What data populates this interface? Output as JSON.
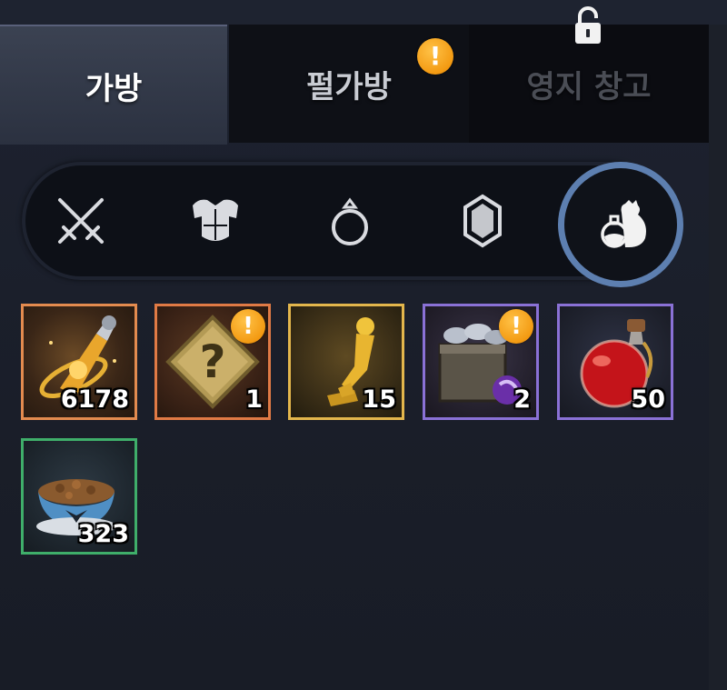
{
  "tabs": {
    "bag": "가방",
    "pearl_bag": "펄가방",
    "territory_storage": "영지 창고"
  },
  "alert_mark": "!",
  "filters": [
    {
      "name": "weapon-filter",
      "icon": "crossed-swords-icon",
      "active": false
    },
    {
      "name": "armor-filter",
      "icon": "armor-icon",
      "active": false
    },
    {
      "name": "accessory-filter",
      "icon": "ring-icon",
      "active": false
    },
    {
      "name": "gem-filter",
      "icon": "crystal-icon",
      "active": false
    },
    {
      "name": "consumable-filter",
      "icon": "potion-pouch-icon",
      "active": true
    }
  ],
  "items": [
    {
      "name": "elixir-item",
      "icon": "golden-elixir-icon",
      "count": "6178",
      "grade_color": "#e38b4f",
      "alert": false
    },
    {
      "name": "mystery-box-item",
      "icon": "question-box-icon",
      "count": "1",
      "grade_color": "#e07a45",
      "alert": true
    },
    {
      "name": "trophy-item",
      "icon": "golden-statue-icon",
      "count": "15",
      "grade_color": "#e3b64c",
      "alert": false
    },
    {
      "name": "fish-chest-item",
      "icon": "fish-chest-icon",
      "count": "2",
      "grade_color": "#8a71d6",
      "alert": true
    },
    {
      "name": "red-potion-item",
      "icon": "red-potion-icon",
      "count": "50",
      "grade_color": "#8a71d6",
      "alert": false
    },
    {
      "name": "pet-food-item",
      "icon": "pet-food-bowl-icon",
      "count": "323",
      "grade_color": "#3fae6a",
      "alert": false
    }
  ],
  "colors": {
    "active_ring": "#5d7fb0",
    "alert": "#f39a12",
    "background": "#1b1f2a"
  }
}
